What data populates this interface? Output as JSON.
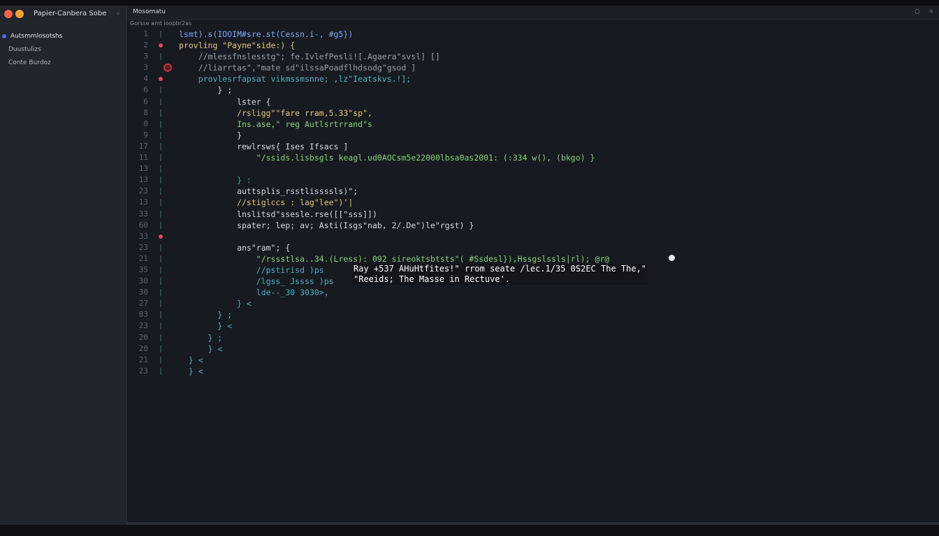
{
  "window": {
    "app_title": "Papier-Canbera Sobe",
    "tab_title": "Mosomatu",
    "breadcrumb": "Gorsse  amt  loopbr2as",
    "tab_icons": [
      "square-icon",
      "close-icon"
    ]
  },
  "sidebar": {
    "items": [
      {
        "label": "Autsmmlosotshs",
        "active": true
      },
      {
        "label": "Duustulizs",
        "active": false
      },
      {
        "label": "Conte Burdoz",
        "active": false
      }
    ]
  },
  "editor": {
    "lines": [
      {
        "n": "1",
        "marker": "bar",
        "code": "lsmt).s(IOOIM#sre.st(Cessn.i-, #g5})"
      },
      {
        "n": "2",
        "marker": "dot",
        "code": "provling \"Payne\"side:) {"
      },
      {
        "n": "3",
        "marker": "bar",
        "code": "    //mlessfnslesstg\"; fe.IvlefPesli![.Agaera\"svsl] []"
      },
      {
        "n": "3",
        "marker": "ring",
        "code": "    //liarrtas\",\"mate sd\"ilssaPoadflhdsodg\"gsod ]"
      },
      {
        "n": "4",
        "marker": "dot",
        "code": "    provlesrfapsat vikmssmsnne; ,lz\"Ieatskvs.!];"
      },
      {
        "n": "6",
        "marker": "bar",
        "code": "        } ;"
      },
      {
        "n": "6",
        "marker": "bar",
        "code": "            lster {"
      },
      {
        "n": "8",
        "marker": "bar",
        "code": "            /rsligg\"\"fare rram,5.33\"sp\","
      },
      {
        "n": "0",
        "marker": "bar",
        "code": "            Ins.ase,\" reg Autlsrtrrand\"s"
      },
      {
        "n": "9",
        "marker": "bar",
        "code": "            }"
      },
      {
        "n": "17",
        "marker": "bar",
        "code": "            rewlrsws{ Ises Ifsacs ]"
      },
      {
        "n": "11",
        "marker": "bar",
        "code": "                \"/ssids.lisbsgls keagl.ud0AOCsm5e22000lbsa0as2001: (:334 w(), (bkgo) }"
      },
      {
        "n": "13",
        "marker": "bar",
        "code": ""
      },
      {
        "n": "13",
        "marker": "bar",
        "code": "            } :"
      },
      {
        "n": "23",
        "marker": "bar",
        "code": "            auttsplis_rsstlissssls)\";"
      },
      {
        "n": "13",
        "marker": "bar",
        "code": "            //stiglccs : lag\"lee\")'|"
      },
      {
        "n": "33",
        "marker": "bar",
        "code": "            lnslitsd\"ssesle.rse([[\"sss]])"
      },
      {
        "n": "60",
        "marker": "bar",
        "code": "            spater; lep; av; Asti(Isgs\"nab, 2/.De\")le\"rgst) }"
      },
      {
        "n": "33",
        "marker": "dot",
        "code": ""
      },
      {
        "n": "23",
        "marker": "bar",
        "code": "            ans\"ram\"; {"
      },
      {
        "n": "21",
        "marker": "bar",
        "code": "                \"/rssstlsa..34.(Lress): 092 sireoktsbtsts\"( #Ssdesl}),Hssgslssls|rl); @r@"
      },
      {
        "n": "35",
        "marker": "bar",
        "code": "                //pstirisd )ps"
      },
      {
        "n": "30",
        "marker": "bar",
        "code": "                /lgss_ Jssss )ps"
      },
      {
        "n": "30",
        "marker": "bar",
        "code": "                lde--_30 3030>,"
      },
      {
        "n": "27",
        "marker": "bar",
        "code": "            } <"
      },
      {
        "n": "83",
        "marker": "bar",
        "code": "        } ;"
      },
      {
        "n": "23",
        "marker": "bar",
        "code": "        } <"
      },
      {
        "n": "20",
        "marker": "bar",
        "code": "      } ;"
      },
      {
        "n": "20",
        "marker": "bar",
        "code": "      } <"
      },
      {
        "n": "21",
        "marker": "bar",
        "code": "  } <"
      },
      {
        "n": "23",
        "marker": "bar",
        "code": "  } <"
      }
    ]
  },
  "tooltip": {
    "line1": "Ray +537 AHuHtfites!\" rrom seate /lec.1/35 0S2EC The The,\"",
    "line2": "\"Reeids; The Masse in Rectuve'."
  },
  "colors": {
    "background": "#16181d",
    "sidebar": "#22252c",
    "accent": "#3f6df2",
    "breakpoint": "#d94b5b"
  }
}
